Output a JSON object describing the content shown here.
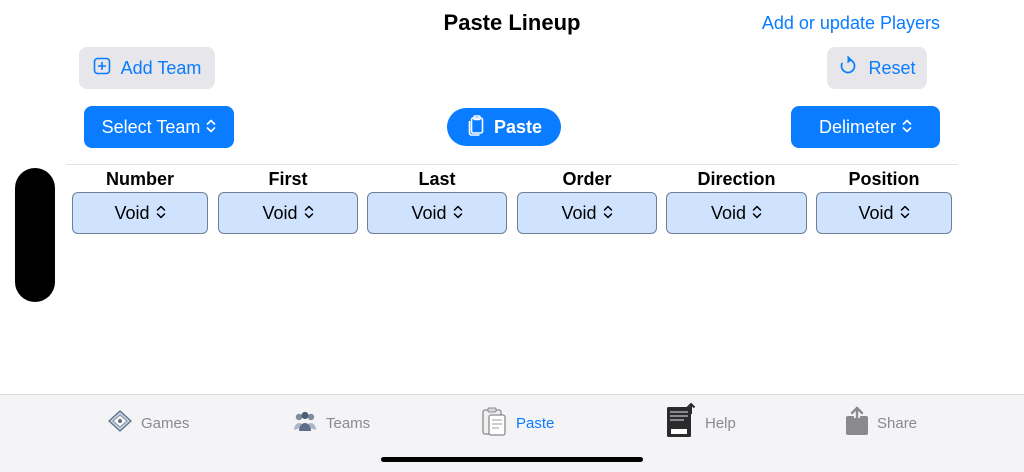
{
  "header": {
    "title": "Paste Lineup",
    "add_players_link": "Add or update Players"
  },
  "toolbar": {
    "add_team_label": "Add Team",
    "reset_label": "Reset",
    "select_team_label": "Select Team",
    "paste_label": "Paste",
    "delimiter_label": "Delimeter",
    "accent_color": "#0a7cff"
  },
  "columns": [
    {
      "header": "Number",
      "value": "Void"
    },
    {
      "header": "First",
      "value": "Void"
    },
    {
      "header": "Last",
      "value": "Void"
    },
    {
      "header": "Order",
      "value": "Void"
    },
    {
      "header": "Direction",
      "value": "Void"
    },
    {
      "header": "Position",
      "value": "Void"
    }
  ],
  "tabs": [
    {
      "label": "Games",
      "icon": "diamond-icon",
      "active": false
    },
    {
      "label": "Teams",
      "icon": "team-icon",
      "active": false
    },
    {
      "label": "Paste",
      "icon": "clipboard-icon",
      "active": true
    },
    {
      "label": "Help",
      "icon": "document-icon",
      "active": false
    },
    {
      "label": "Share",
      "icon": "share-icon",
      "active": false
    }
  ]
}
